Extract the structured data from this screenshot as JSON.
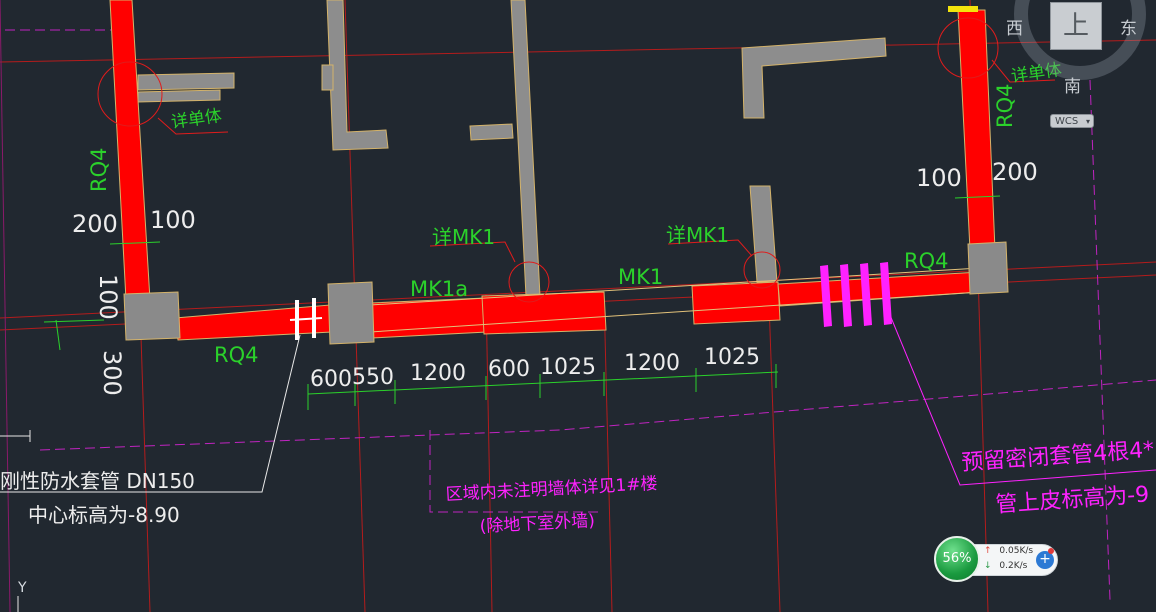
{
  "drawing": {
    "labels": {
      "detail_left": "详单体",
      "detail_right": "详单体",
      "rq4_left_vertical": "RQ4",
      "rq4_bottom": "RQ4",
      "rq4_right_vertical": "RQ4",
      "rq4_right": "RQ4",
      "mk1a": "MK1a",
      "mk1_center": "MK1",
      "mk1_detail_a": "详MK1",
      "mk1_detail_b": "详MK1"
    },
    "dimensions": {
      "left_200": "200",
      "left_100": "100",
      "left_vertical_100": "100",
      "left_vertical_300": "300",
      "right_100": "100",
      "right_200": "200",
      "bottom_chain": [
        "600",
        "550",
        "1200",
        "600",
        "1025",
        "1200",
        "1025"
      ]
    },
    "notes": {
      "pipe_name": "刚性防水套管 DN150",
      "pipe_elev": "中心标高为-8.90",
      "region_note": "区域内未注明墙体详见1#楼",
      "region_sub": "(除地下室外墙)",
      "sleeve_note": "预留密闭套管4根4*",
      "sleeve_elev": "管上皮标高为-9"
    }
  },
  "viewcube": {
    "face": "上",
    "west": "西",
    "east": "东",
    "south": "南",
    "wcs": "WCS",
    "wcs_caret": "▾"
  },
  "network": {
    "percent": "56%",
    "up_arrow": "↑",
    "up_rate": "0.05K/s",
    "down_arrow": "↓",
    "down_rate": "0.2K/s",
    "plus": "+"
  },
  "ucs": {
    "y_label": "Y"
  },
  "colors": {
    "background": "#212830",
    "wall": "#ff0000",
    "column": "#8a8a8a",
    "dimension": "#2bd12b",
    "annotation": "#ff22ff",
    "grid_red": "#c01d1d"
  }
}
